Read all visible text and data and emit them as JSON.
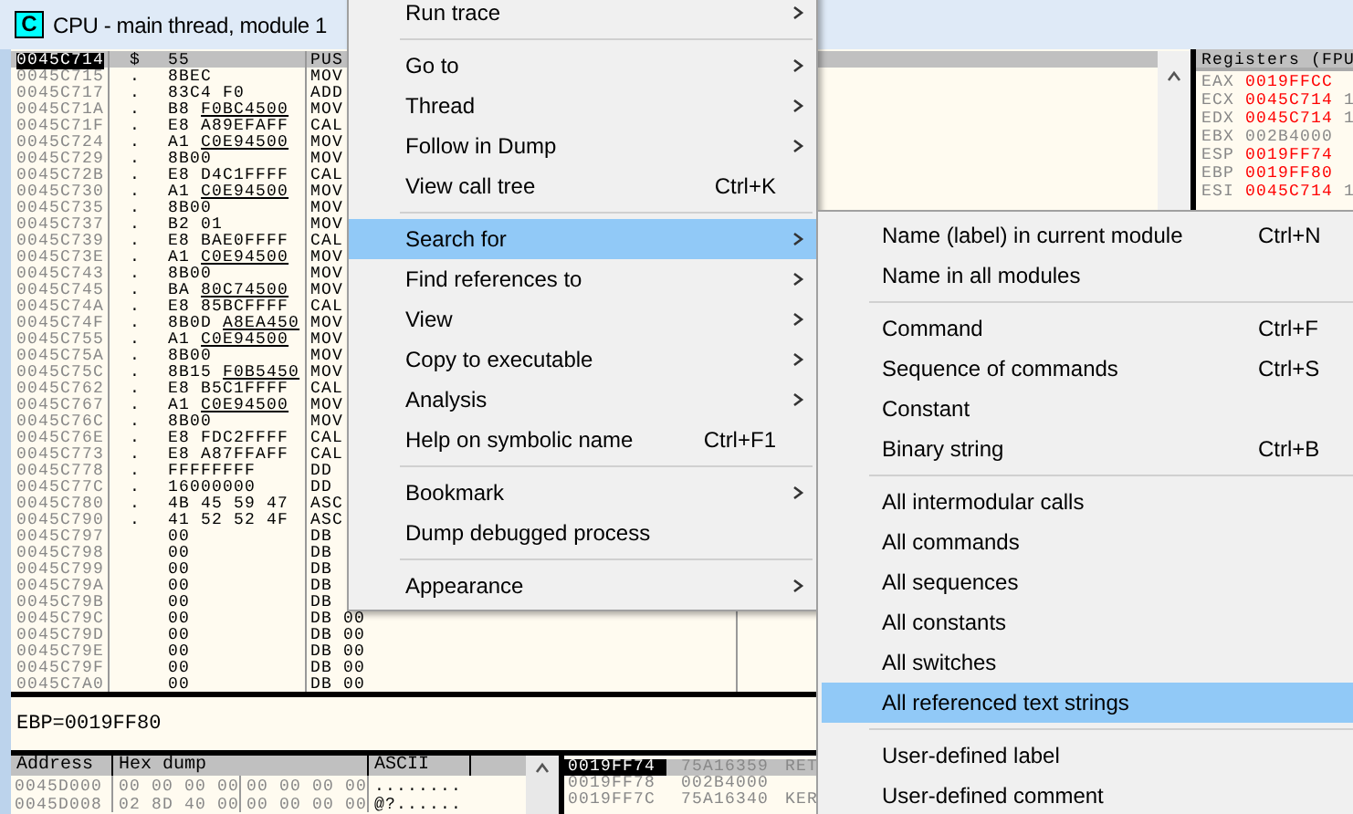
{
  "window": {
    "icon_letter": "C",
    "title": "CPU - main thread, module 1"
  },
  "disassembly": {
    "rows": [
      {
        "address": "0045C714",
        "marker": "$",
        "hex": "55",
        "mnemonic": "PUS",
        "selected": true
      },
      {
        "address": "0045C715",
        "marker": ".",
        "hex": "8BEC",
        "mnemonic": "MOV",
        "selected": false
      },
      {
        "address": "0045C717",
        "marker": ".",
        "hex": "83C4 F0",
        "mnemonic": "ADD",
        "selected": false
      },
      {
        "address": "0045C71A",
        "marker": ".",
        "hex": "B8",
        "ref": "F0BC4500",
        "mnemonic": "MOV",
        "selected": false
      },
      {
        "address": "0045C71F",
        "marker": ".",
        "hex": "E8 A89EFAFF",
        "mnemonic": "CAL",
        "selected": false
      },
      {
        "address": "0045C724",
        "marker": ".",
        "hex": "A1",
        "ref": "C0E94500",
        "mnemonic": "MOV",
        "selected": false
      },
      {
        "address": "0045C729",
        "marker": ".",
        "hex": "8B00",
        "mnemonic": "MOV",
        "selected": false
      },
      {
        "address": "0045C72B",
        "marker": ".",
        "hex": "E8 D4C1FFFF",
        "mnemonic": "CAL",
        "selected": false
      },
      {
        "address": "0045C730",
        "marker": ".",
        "hex": "A1",
        "ref": "C0E94500",
        "mnemonic": "MOV",
        "selected": false
      },
      {
        "address": "0045C735",
        "marker": ".",
        "hex": "8B00",
        "mnemonic": "MOV",
        "selected": false
      },
      {
        "address": "0045C737",
        "marker": ".",
        "hex": "B2 01",
        "mnemonic": "MOV",
        "selected": false
      },
      {
        "address": "0045C739",
        "marker": ".",
        "hex": "E8 BAE0FFFF",
        "mnemonic": "CAL",
        "selected": false
      },
      {
        "address": "0045C73E",
        "marker": ".",
        "hex": "A1",
        "ref": "C0E94500",
        "mnemonic": "MOV",
        "selected": false
      },
      {
        "address": "0045C743",
        "marker": ".",
        "hex": "8B00",
        "mnemonic": "MOV",
        "selected": false
      },
      {
        "address": "0045C745",
        "marker": ".",
        "hex": "BA",
        "ref": "80C74500",
        "mnemonic": "MOV",
        "selected": false
      },
      {
        "address": "0045C74A",
        "marker": ".",
        "hex": "E8 85BCFFFF",
        "mnemonic": "CAL",
        "selected": false
      },
      {
        "address": "0045C74F",
        "marker": ".",
        "hex": "8B0D",
        "ref": "A8EA450",
        "mnemonic": "MOV",
        "selected": false
      },
      {
        "address": "0045C755",
        "marker": ".",
        "hex": "A1",
        "ref": "C0E94500",
        "mnemonic": "MOV",
        "selected": false
      },
      {
        "address": "0045C75A",
        "marker": ".",
        "hex": "8B00",
        "mnemonic": "MOV",
        "selected": false
      },
      {
        "address": "0045C75C",
        "marker": ".",
        "hex": "8B15",
        "ref": "F0B5450",
        "mnemonic": "MOV",
        "selected": false
      },
      {
        "address": "0045C762",
        "marker": ".",
        "hex": "E8 B5C1FFFF",
        "mnemonic": "CAL",
        "selected": false
      },
      {
        "address": "0045C767",
        "marker": ".",
        "hex": "A1",
        "ref": "C0E94500",
        "mnemonic": "MOV",
        "selected": false
      },
      {
        "address": "0045C76C",
        "marker": ".",
        "hex": "8B00",
        "mnemonic": "MOV",
        "selected": false
      },
      {
        "address": "0045C76E",
        "marker": ".",
        "hex": "E8 FDC2FFFF",
        "mnemonic": "CAL",
        "selected": false
      },
      {
        "address": "0045C773",
        "marker": ".",
        "hex": "E8 A87FFAFF",
        "mnemonic": "CAL",
        "selected": false
      },
      {
        "address": "0045C778",
        "marker": ".",
        "hex": "FFFFFFFF",
        "mnemonic": "DD",
        "selected": false
      },
      {
        "address": "0045C77C",
        "marker": ".",
        "hex": "16000000",
        "mnemonic": "DD",
        "selected": false
      },
      {
        "address": "0045C780",
        "marker": ".",
        "hex": "4B 45 59 47",
        "mnemonic": "ASC",
        "selected": false
      },
      {
        "address": "0045C790",
        "marker": ".",
        "hex": "41 52 52 4F",
        "mnemonic": "ASC",
        "selected": false
      },
      {
        "address": "0045C797",
        "hex": "00",
        "mnemonic": "DB",
        "selected": false
      },
      {
        "address": "0045C798",
        "hex": "00",
        "mnemonic": "DB",
        "selected": false
      },
      {
        "address": "0045C799",
        "hex": "00",
        "mnemonic": "DB",
        "selected": false
      },
      {
        "address": "0045C79A",
        "hex": "00",
        "mnemonic": "DB",
        "selected": false
      },
      {
        "address": "0045C79B",
        "hex": "00",
        "mnemonic": "DB",
        "selected": false
      },
      {
        "address": "0045C79C",
        "hex": "00",
        "mnemonic": "DB 00",
        "selected": false
      },
      {
        "address": "0045C79D",
        "hex": "00",
        "mnemonic": "DB 00",
        "selected": false
      },
      {
        "address": "0045C79E",
        "hex": "00",
        "mnemonic": "DB 00",
        "selected": false
      },
      {
        "address": "0045C79F",
        "hex": "00",
        "mnemonic": "DB 00",
        "selected": false
      },
      {
        "address": "0045C7A0",
        "hex": "00",
        "mnemonic": "DB 00",
        "selected": false
      }
    ]
  },
  "registers": {
    "title": "Registers (FPU",
    "rows": [
      {
        "name": "EAX",
        "value": "0019FFCC",
        "changed": true
      },
      {
        "name": "ECX",
        "value": "0045C714",
        "extra": "1",
        "changed": true
      },
      {
        "name": "EDX",
        "value": "0045C714",
        "extra": "1",
        "changed": true
      },
      {
        "name": "EBX",
        "value": "002B4000",
        "changed": false
      },
      {
        "name": "ESP",
        "value": "0019FF74",
        "changed": true
      },
      {
        "name": "EBP",
        "value": "0019FF80",
        "changed": true
      },
      {
        "name": "ESI",
        "value": "0045C714",
        "extra": "1",
        "changed": true
      }
    ]
  },
  "info": {
    "text": "EBP=0019FF80"
  },
  "dump": {
    "columns": [
      "Address",
      "Hex dump",
      "ASCII"
    ],
    "rows": [
      {
        "address": "0045D000",
        "hex_1": "00 00 00 00",
        "hex_2": "00 00 00 00",
        "ascii": "........"
      },
      {
        "address": "0045D008",
        "hex_1": "02 8D 40 00",
        "hex_2": "00 00 00 00",
        "ascii": "@?......"
      }
    ]
  },
  "stack": {
    "rows": [
      {
        "address": "0019FF74",
        "value": "75A16359",
        "comment": "RET",
        "selected": true
      },
      {
        "address": "0019FF78",
        "value": "002B4000",
        "selected": false
      },
      {
        "address": "0019FF7C",
        "value": "75A16340",
        "comment": "KER",
        "selected": false
      }
    ]
  },
  "context_menu": {
    "items": [
      {
        "kind": "item",
        "label": "Run trace",
        "submenu": true,
        "selected": false
      },
      {
        "kind": "separator"
      },
      {
        "kind": "item",
        "label": "Go to",
        "submenu": true,
        "selected": false
      },
      {
        "kind": "item",
        "label": "Thread",
        "submenu": true,
        "selected": false
      },
      {
        "kind": "item",
        "label": "Follow in Dump",
        "submenu": true,
        "selected": false
      },
      {
        "kind": "item",
        "label": "View call tree",
        "shortcut": "Ctrl+K",
        "submenu": false,
        "selected": false
      },
      {
        "kind": "separator"
      },
      {
        "kind": "item",
        "label": "Search for",
        "submenu": true,
        "selected": true
      },
      {
        "kind": "item",
        "label": "Find references to",
        "submenu": true,
        "selected": false
      },
      {
        "kind": "item",
        "label": "View",
        "submenu": true,
        "selected": false
      },
      {
        "kind": "item",
        "label": "Copy to executable",
        "submenu": true,
        "selected": false
      },
      {
        "kind": "item",
        "label": "Analysis",
        "submenu": true,
        "selected": false
      },
      {
        "kind": "item",
        "label": "Help on symbolic name",
        "shortcut": "Ctrl+F1",
        "submenu": false,
        "selected": false
      },
      {
        "kind": "separator"
      },
      {
        "kind": "item",
        "label": "Bookmark",
        "submenu": true,
        "selected": false
      },
      {
        "kind": "item",
        "label": "Dump debugged process",
        "submenu": false,
        "selected": false
      },
      {
        "kind": "separator"
      },
      {
        "kind": "item",
        "label": "Appearance",
        "submenu": true,
        "selected": false
      }
    ]
  },
  "submenu": {
    "items": [
      {
        "kind": "item",
        "label": "Name (label) in current module",
        "shortcut": "Ctrl+N",
        "selected": false
      },
      {
        "kind": "item",
        "label": "Name in all modules",
        "selected": false
      },
      {
        "kind": "separator"
      },
      {
        "kind": "item",
        "label": "Command",
        "shortcut": "Ctrl+F",
        "selected": false
      },
      {
        "kind": "item",
        "label": "Sequence of commands",
        "shortcut": "Ctrl+S",
        "selected": false
      },
      {
        "kind": "item",
        "label": "Constant",
        "selected": false
      },
      {
        "kind": "item",
        "label": "Binary string",
        "shortcut": "Ctrl+B",
        "selected": false
      },
      {
        "kind": "separator"
      },
      {
        "kind": "item",
        "label": "All intermodular calls",
        "selected": false
      },
      {
        "kind": "item",
        "label": "All commands",
        "selected": false
      },
      {
        "kind": "item",
        "label": "All sequences",
        "selected": false
      },
      {
        "kind": "item",
        "label": "All constants",
        "selected": false
      },
      {
        "kind": "item",
        "label": "All switches",
        "selected": false
      },
      {
        "kind": "item",
        "label": "All referenced text strings",
        "selected": true
      },
      {
        "kind": "separator"
      },
      {
        "kind": "item",
        "label": "User-defined label",
        "selected": false
      },
      {
        "kind": "item",
        "label": "User-defined comment",
        "selected": false
      }
    ]
  }
}
